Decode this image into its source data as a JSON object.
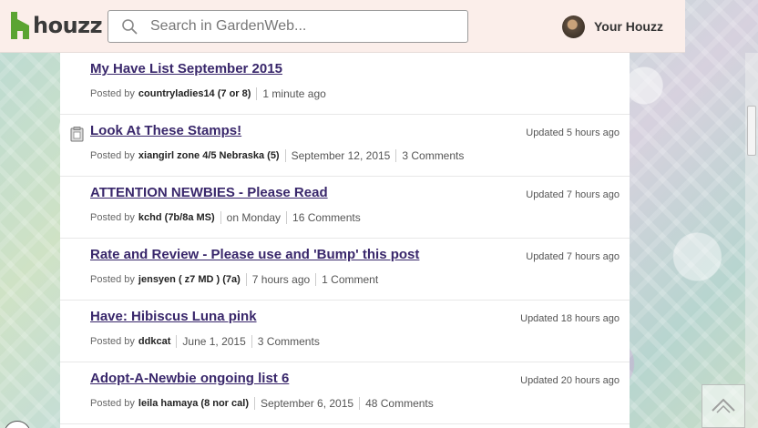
{
  "header": {
    "logo_text": "houzz",
    "search_placeholder": "Search in GardenWeb...",
    "user_label": "Your Houzz"
  },
  "discussions": [
    {
      "title": "My Have List September 2015",
      "posted_by_prefix": "Posted by",
      "author": "countryladies14 (7 or 8)",
      "date": "1 minute ago",
      "comments": "",
      "updated": "",
      "icon": ""
    },
    {
      "title": "Look At These Stamps!",
      "posted_by_prefix": "Posted by",
      "author": "xiangirl zone 4/5 Nebraska (5)",
      "date": "September 12, 2015",
      "comments": "3 Comments",
      "updated": "Updated 5 hours ago",
      "icon": "clipboard-icon"
    },
    {
      "title": "ATTENTION NEWBIES - Please Read",
      "posted_by_prefix": "Posted by",
      "author": "kchd (7b/8a MS)",
      "date": "on Monday",
      "comments": "16 Comments",
      "updated": "Updated 7 hours ago",
      "icon": ""
    },
    {
      "title": "Rate and Review - Please use and 'Bump' this post",
      "posted_by_prefix": "Posted by",
      "author": "jensyen ( z7 MD ) (7a)",
      "date": "7 hours ago",
      "comments": "1 Comment",
      "updated": "Updated 7 hours ago",
      "icon": ""
    },
    {
      "title": "Have: Hibiscus Luna pink",
      "posted_by_prefix": "Posted by",
      "author": "ddkcat",
      "date": "June 1, 2015",
      "comments": "3 Comments",
      "updated": "Updated 18 hours ago",
      "icon": ""
    },
    {
      "title": "Adopt-A-Newbie ongoing list 6",
      "posted_by_prefix": "Posted by",
      "author": "leila hamaya (8 nor cal)",
      "date": "September 6, 2015",
      "comments": "48 Comments",
      "updated": "Updated 20 hours ago",
      "icon": ""
    }
  ],
  "colors": {
    "link": "#39276b",
    "header_bg": "#fbeeea",
    "logo_green": "#5aa432"
  }
}
